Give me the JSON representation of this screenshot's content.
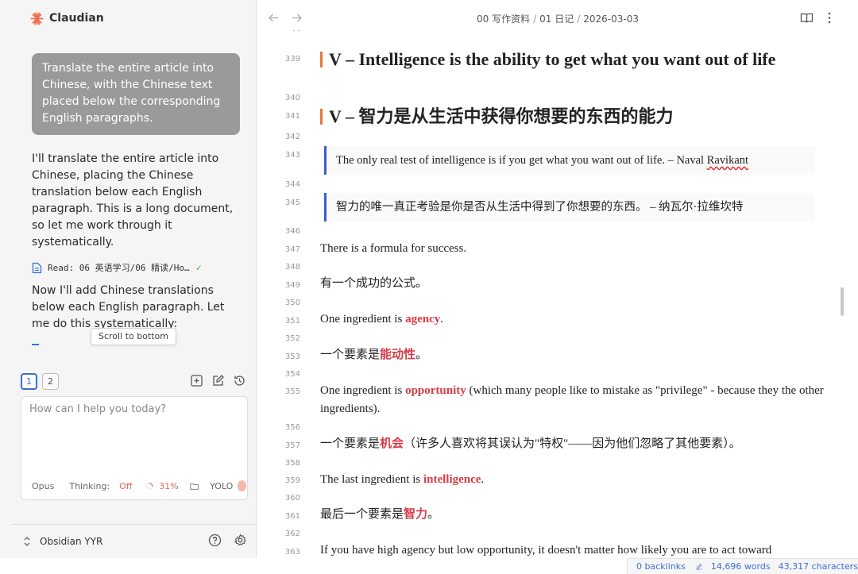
{
  "sidebar": {
    "app_title": "Claudian",
    "user_message": "Translate the entire article into Chinese, with the Chinese text placed below the corresponding English paragraphs.",
    "assistant_message_1": "I'll translate the entire article into Chinese, placing the Chinese translation below each English paragraph. This is a long document, so let me work through it systematically.",
    "tool_call": "Read: 06 英语学习/06 精读/Ho…",
    "assistant_message_2": "Now I'll add Chinese translations below each English paragraph. Let me do this systematically:",
    "scroll_tooltip": "Scroll to bottom",
    "tabs": [
      "1",
      "2"
    ],
    "composer": {
      "placeholder": "How can I help you today?",
      "model": "Opus",
      "thinking_label": "Thinking:",
      "thinking_value": "Off",
      "context_usage": "31%",
      "yolo_label": "YOLO"
    },
    "vault_name": "Obsidian YYR"
  },
  "header": {
    "breadcrumb": [
      "00 写作资料",
      "01 日记",
      "2026-03-03"
    ]
  },
  "editor": {
    "line_numbers": {
      "fold": "- -",
      "l339": "339",
      "l340": "340",
      "l341": "341",
      "l342": "342",
      "l343": "343",
      "l344": "344",
      "l345": "345",
      "l346": "346",
      "l347": "347",
      "l348": "348",
      "l349": "349",
      "l350": "350",
      "l351": "351",
      "l352": "352",
      "l353": "353",
      "l354": "354",
      "l355": "355",
      "l356": "356",
      "l357": "357",
      "l358": "358",
      "l359": "359",
      "l360": "360",
      "l361": "361",
      "l362": "362",
      "l363": "363"
    },
    "heading_en": "V – Intelligence is the ability to get what you want out of life",
    "heading_zh": "V – 智力是从生活中获得你想要的东西的能力",
    "quote_en_text": "The only real test of intelligence is if you get what you want out of life. – Naval ",
    "quote_en_name": "Ravikant",
    "quote_zh": "智力的唯一真正考验是你是否从生活中得到了你想要的东西。 – 纳瓦尔·拉维坎特",
    "p347": "There is a formula for success.",
    "p349": "有一个成功的公式。",
    "p351_pre": "One ingredient is ",
    "p351_hl": "agency",
    "p351_post": ".",
    "p353_pre": "一个要素是",
    "p353_hl": "能动性",
    "p353_post": "。",
    "p355_pre": "One ingredient is ",
    "p355_hl": "opportunity",
    "p355_post": " (which many people like to mistake as \"privilege\" - because they the other ingredients).",
    "p357_pre": "一个要素是",
    "p357_hl": "机会",
    "p357_post": "（许多人喜欢将其误认为\"特权\"——因为他们忽略了其他要素）。",
    "p359_pre": "The last ingredient is ",
    "p359_hl": "intelligence",
    "p359_post": ".",
    "p361_pre": "最后一个要素是",
    "p361_hl": "智力",
    "p361_post": "。",
    "p363": "If you have high agency but low opportunity, it doesn't matter how likely you are to act toward"
  },
  "status_bar": {
    "backlinks": "0 backlinks",
    "words": "14,696 words",
    "characters": "43,317 characters"
  },
  "colors": {
    "accent": "#3b6fd4",
    "highlight": "#d63b47",
    "heading_bar": "#e07b39",
    "user_bubble": "#9a9a9a"
  }
}
